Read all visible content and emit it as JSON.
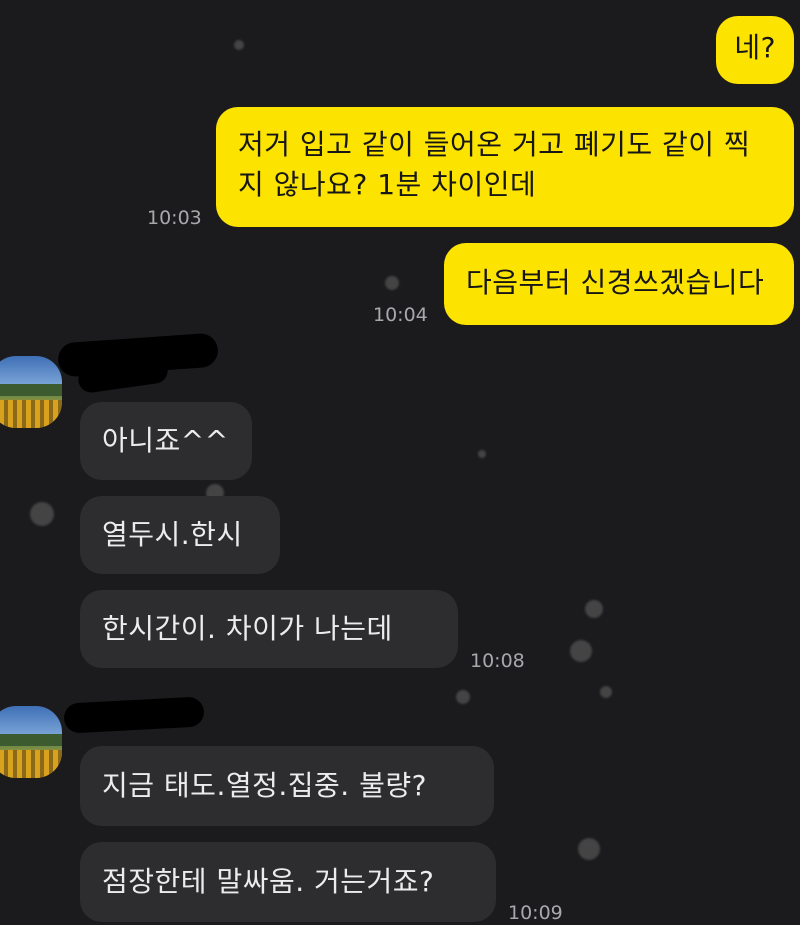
{
  "messages": {
    "m1": {
      "text": "네?"
    },
    "m2": {
      "line1": "저거 입고 같이 들어온 거고 폐기도 같이 찍",
      "line2": "지 않나요? 1분 차이인데",
      "time": "10:03"
    },
    "m3": {
      "text": "다음부터 신경쓰겠습니다",
      "time": "10:04"
    },
    "m4": {
      "text": "아니죠^^"
    },
    "m5": {
      "text": "열두시.한시"
    },
    "m6": {
      "text": "한시간이.  차이가  나는데",
      "time": "10:08"
    },
    "m7": {
      "text": "지금  태도.열정.집중.  불량?"
    },
    "m8": {
      "text": "점장한테  말싸움.  거는거죠?",
      "time": "10:09"
    }
  },
  "colors": {
    "my_bubble": "#fde300",
    "their_bubble": "#2d2d30",
    "background": "#1b1b1d"
  }
}
